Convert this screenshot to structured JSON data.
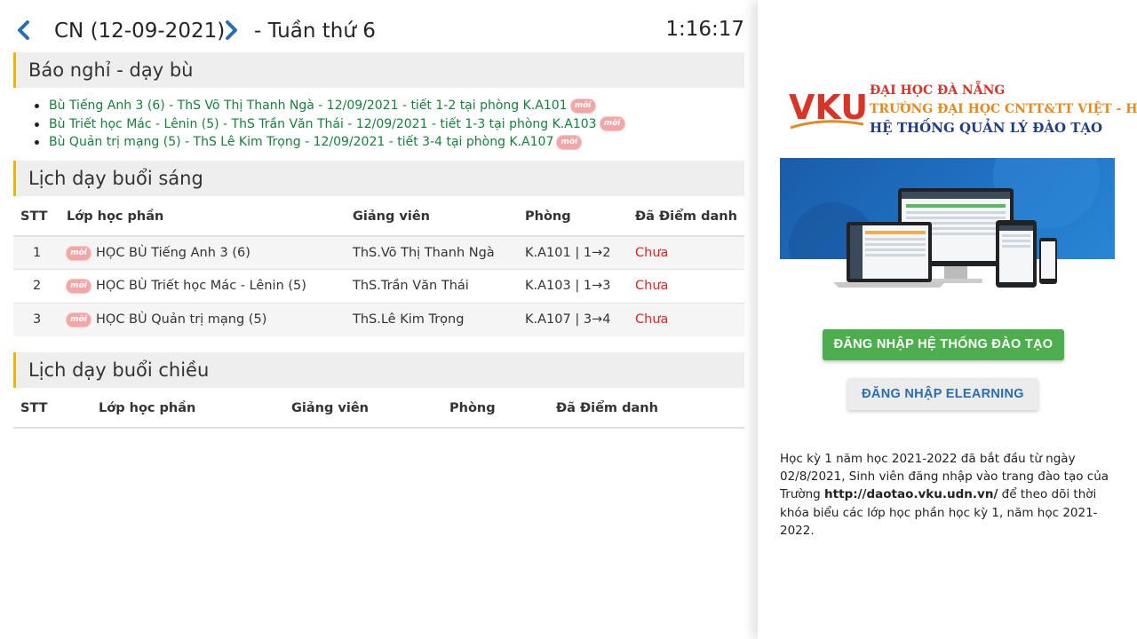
{
  "header": {
    "date_label": "CN (12-09-2021)",
    "week_label": "- Tuần thứ 6",
    "clock": "1:16:17"
  },
  "badge_text": "mới",
  "notices": {
    "title": "Báo nghỉ - dạy bù",
    "items": [
      "Bù Tiếng Anh 3 (6) - ThS Võ Thị Thanh Ngà - 12/09/2021 - tiết 1-2 tại phòng K.A101",
      "Bù Triết học Mác - Lênin (5) - ThS Trần Văn Thái - 12/09/2021 - tiết 1-3 tại phòng K.A103",
      "Bù Quản trị mạng (5) - ThS Lê Kim Trọng - 12/09/2021 - tiết 3-4 tại phòng K.A107"
    ]
  },
  "morning": {
    "title": "Lịch dạy buổi sáng",
    "columns": [
      "STT",
      "Lớp học phần",
      "Giảng viên",
      "Phòng",
      "Đã Điểm danh"
    ],
    "rows": [
      {
        "stt": "1",
        "course": "HỌC BÙ Tiếng Anh 3 (6)",
        "teacher": "ThS.Võ Thị Thanh Ngà",
        "room": "K.A101 | 1→2",
        "status": "Chưa"
      },
      {
        "stt": "2",
        "course": "HỌC BÙ Triết học Mác - Lênin (5)",
        "teacher": "ThS.Trần Văn Thái",
        "room": "K.A103 | 1→3",
        "status": "Chưa"
      },
      {
        "stt": "3",
        "course": "HỌC BÙ Quản trị mạng (5)",
        "teacher": "ThS.Lê Kim Trọng",
        "room": "K.A107 | 3→4",
        "status": "Chưa"
      }
    ]
  },
  "afternoon": {
    "title": "Lịch dạy buổi chiều",
    "columns": [
      "STT",
      "Lớp học phần",
      "Giảng viên",
      "Phòng",
      "Đã Điểm danh"
    ]
  },
  "sidebar": {
    "logo_mark": "VKU",
    "logo_line1": "ĐẠI HỌC ĐÀ NẴNG",
    "logo_line2": "TRƯỜNG ĐẠI HỌC CNTT&TT VIỆT - HÀN",
    "logo_line3": "HỆ THỐNG QUẢN LÝ ĐÀO TẠO",
    "btn_login": "ĐĂNG NHẬP HỆ THỐNG ĐÀO TẠO",
    "btn_elearning": "ĐĂNG NHẬP ELEARNING",
    "info_before": "Học kỳ 1 năm học 2021-2022 đã bắt đầu từ ngày 02/8/2021, Sinh viên đăng nhập vào trang đào tạo của Trường ",
    "info_link": "http://daotao.vku.udn.vn/",
    "info_after": " để theo dõi thời khóa biểu các lớp học phần học kỳ 1, năm học 2021-2022."
  },
  "colors": {
    "accent_bar": "#f0b400",
    "notice_green": "#15803d",
    "status_red": "#dc2626",
    "nav_blue": "#2a6db0",
    "btn_green": "#4cae4c"
  },
  "icons": [
    "chevron-left-icon",
    "chevron-right-icon",
    "new-badge-icon",
    "vku-logo",
    "devices-illustration"
  ]
}
